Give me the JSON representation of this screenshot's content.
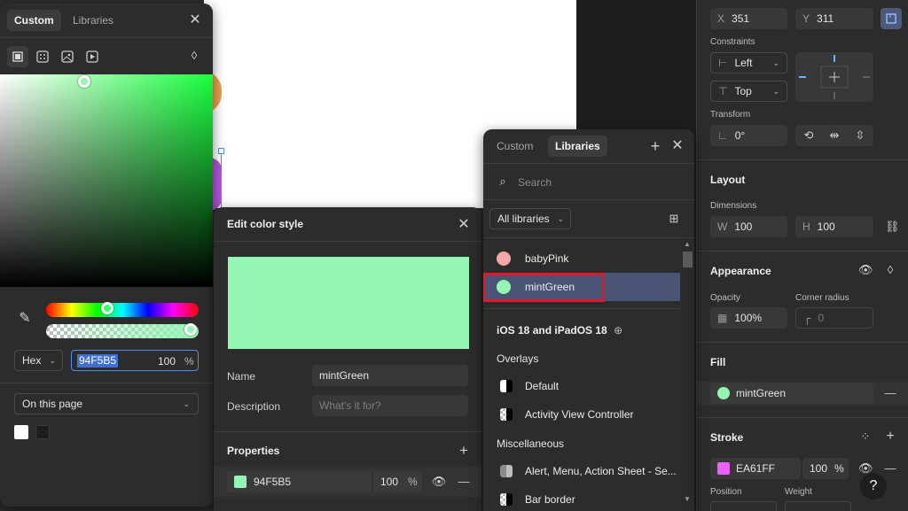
{
  "canvas": {},
  "properties": {
    "position": {
      "x_prefix": "X",
      "x": "351",
      "y_prefix": "Y",
      "y": "311"
    },
    "constraints": {
      "label": "Constraints",
      "horizontal": "Left",
      "vertical": "Top"
    },
    "transform": {
      "label": "Transform",
      "rotation": "0°"
    },
    "layout": {
      "title": "Layout",
      "dimensions_label": "Dimensions",
      "w_prefix": "W",
      "w": "100",
      "h_prefix": "H",
      "h": "100"
    },
    "appearance": {
      "title": "Appearance",
      "opacity_label": "Opacity",
      "opacity": "100%",
      "radius_label": "Corner radius",
      "radius": "0"
    },
    "fill": {
      "title": "Fill",
      "style_name": "mintGreen",
      "color": "#94F5B5"
    },
    "stroke": {
      "title": "Stroke",
      "hex": "EA61FF",
      "opacity": "100",
      "percent": "%",
      "color": "#EA61FF",
      "position_label": "Position",
      "weight_label": "Weight"
    },
    "help": "?"
  },
  "color_picker": {
    "tabs": [
      "Custom",
      "Libraries"
    ],
    "active_tab": "Custom",
    "mode": "Hex",
    "hex": "94F5B5",
    "opacity": "100",
    "percent": "%",
    "page_selector": "On this page",
    "swatches": [
      "#ffffff",
      "#1e1e1e"
    ]
  },
  "edit_style": {
    "title": "Edit color style",
    "preview_color": "#94F5B5",
    "name_label": "Name",
    "name_value": "mintGreen",
    "description_label": "Description",
    "description_placeholder": "What's it for?",
    "properties_title": "Properties",
    "prop_hex": "94F5B5",
    "prop_opacity": "100",
    "prop_percent": "%"
  },
  "libraries": {
    "tabs": [
      "Custom",
      "Libraries"
    ],
    "active_tab": "Libraries",
    "search_placeholder": "Search",
    "filter": "All libraries",
    "local_styles": [
      {
        "name": "babyPink",
        "color": "#F4A7A7"
      },
      {
        "name": "mintGreen",
        "color": "#94F5B5",
        "selected": true
      }
    ],
    "library_name": "iOS 18 and iPadOS 18",
    "groups": [
      {
        "title": "Overlays",
        "items": [
          "Default",
          "Activity View Controller"
        ]
      },
      {
        "title": "Miscellaneous",
        "items": [
          "Alert, Menu, Action Sheet - Se...",
          "Bar border"
        ]
      }
    ]
  },
  "accent": {
    "selection": "#E8152B",
    "selected_row": "#4A5576",
    "blue": "#4C8DFF"
  }
}
